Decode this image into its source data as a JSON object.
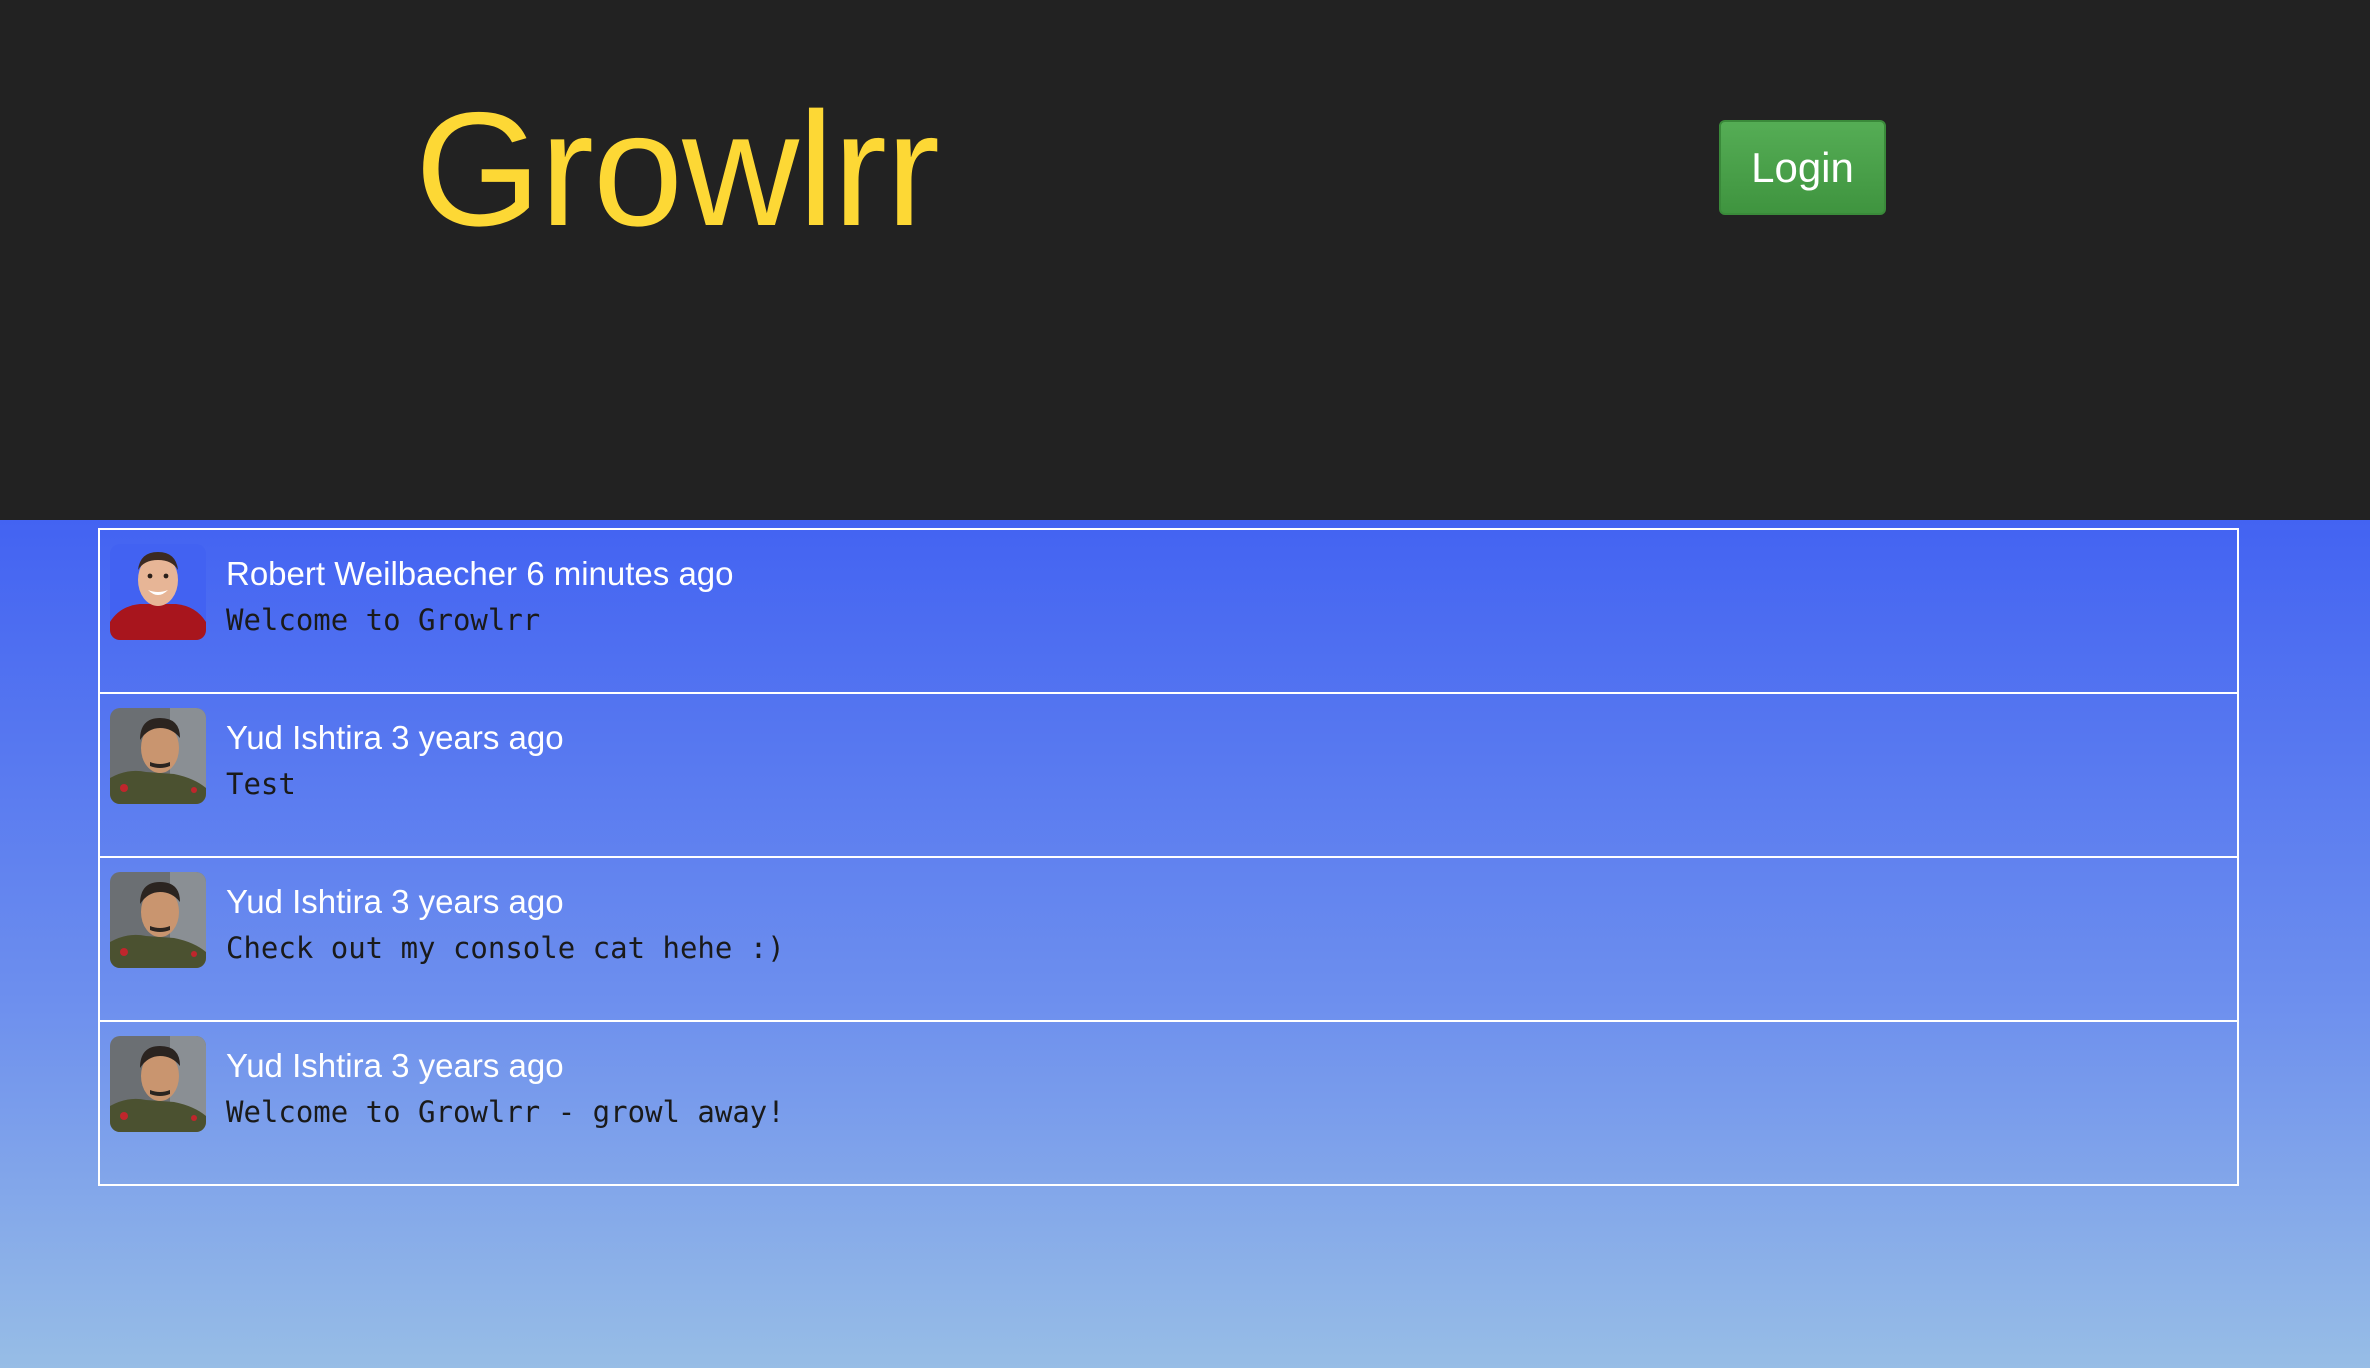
{
  "header": {
    "brand": "Growlrr",
    "login_label": "Login",
    "brand_color": "#fdd835",
    "login_color": "#4aa34a"
  },
  "posts": [
    {
      "author": "Robert Weilbaecher",
      "time": "6 minutes ago",
      "message": "Welcome to Growlrr",
      "avatar_icon": "smiling-man-avatar"
    },
    {
      "author": "Yud Ishtira",
      "time": "3 years ago",
      "message": "Test",
      "avatar_icon": "uniformed-man-avatar"
    },
    {
      "author": "Yud Ishtira",
      "time": "3 years ago",
      "message": "Check out my console cat hehe :)",
      "avatar_icon": "uniformed-man-avatar"
    },
    {
      "author": "Yud Ishtira",
      "time": "3 years ago",
      "message": "Welcome to Growlrr - growl away!",
      "avatar_icon": "uniformed-man-avatar"
    }
  ]
}
